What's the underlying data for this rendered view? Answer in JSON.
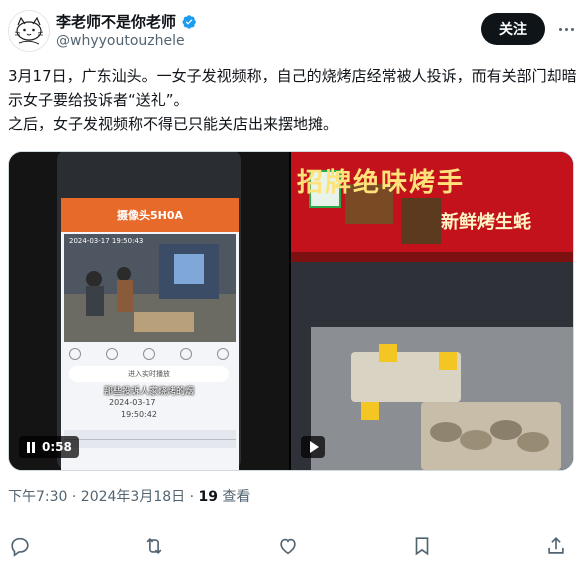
{
  "author": {
    "display_name": "李老师不是你老师",
    "handle": "@whyyoutouzhele",
    "verified": true
  },
  "header": {
    "follow_label": "关注"
  },
  "tweet": {
    "paragraphs": [
      "3月17日，广东汕头。一女子发视频称，自己的烧烤店经常被人投诉，而有关部门却暗示女子要给投诉者“送礼”。",
      "之后，女子发视频称不得已只能关店出来摆地摊。"
    ]
  },
  "media": {
    "video1": {
      "duration": "0:58",
      "camera_title": "摄像头5H0A",
      "cam_timestamp": "2024-03-17  19:50:43",
      "live_button": "进入实时播放",
      "overlay_caption": "那些投诉人家烧烤的烟",
      "playback_date": "2024-03-17",
      "playback_time": "19:50:42"
    },
    "video2": {
      "sign_text": "招牌绝味烤手",
      "sign_text2": "新鲜烤生蚝"
    }
  },
  "meta": {
    "timestamp": "下午7:30 · 2024年3月18日 · ",
    "views_count": "19",
    "views_label": " 查看"
  },
  "actions": [
    "reply",
    "retweet",
    "like",
    "bookmark",
    "share"
  ],
  "colors": {
    "follow_bg": "#0f1419",
    "verified_blue": "#1d9bf0",
    "secondary_text": "#536471",
    "sign_red": "#c3121b"
  }
}
